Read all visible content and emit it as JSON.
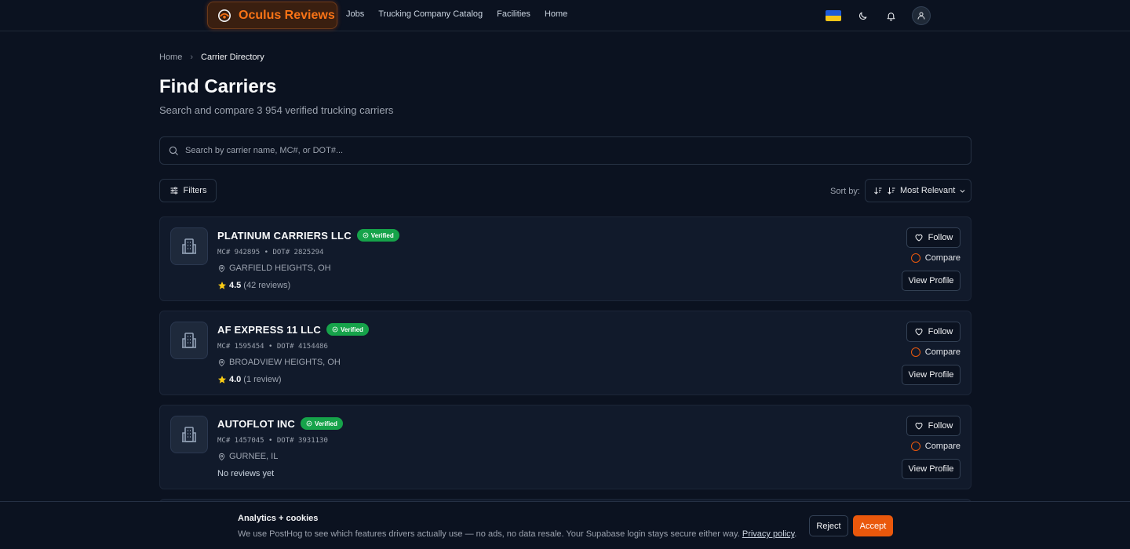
{
  "nav": {
    "brand": "Oculus Reviews",
    "links": [
      "Jobs",
      "Trucking Company Catalog",
      "Facilities",
      "Home"
    ]
  },
  "breadcrumb": {
    "home": "Home",
    "separator": "›",
    "current": "Carrier Directory"
  },
  "page": {
    "title": "Find Carriers",
    "subtitle": "Search and compare 3 954 verified trucking carriers"
  },
  "search": {
    "placeholder": "Search by carrier name, MC#, or DOT#...",
    "value": ""
  },
  "toolbar": {
    "filters_label": "Filters",
    "sort_label": "Sort by:",
    "sort_value": "Most Relevant"
  },
  "carriers": [
    {
      "name": "PLATINUM CARRIERS LLC",
      "badge": "Verified",
      "ids": "MC# 942895 • DOT# 2825294",
      "location": "GARFIELD HEIGHTS, OH",
      "rating": "4.5",
      "reviews": "(42 reviews)"
    },
    {
      "name": "AF EXPRESS 11 LLC",
      "badge": "Verified",
      "ids": "MC# 1595454 • DOT# 4154486",
      "location": "BROADVIEW HEIGHTS, OH",
      "rating": "4.0",
      "reviews": "(1 review)"
    },
    {
      "name": "AUTOFLOT INC",
      "badge": "Verified",
      "ids": "MC# 1457045 • DOT# 3931130",
      "location": "GURNEE, IL",
      "no_reviews": "No reviews yet"
    }
  ],
  "card_actions": {
    "follow": "Follow",
    "compare": "Compare",
    "view": "View Profile"
  },
  "cookie": {
    "title": "Analytics + cookies",
    "text": "We use PostHog to see which features drivers actually use — no ads, no data resale. Your Supabase login stays secure either way.",
    "link": "Privacy policy",
    "period": ".",
    "reject": "Reject",
    "accept": "Accept"
  },
  "colors": {
    "accent": "#ea580c",
    "verified": "#16a34a",
    "background": "#0b1220",
    "card": "#111a2b"
  }
}
